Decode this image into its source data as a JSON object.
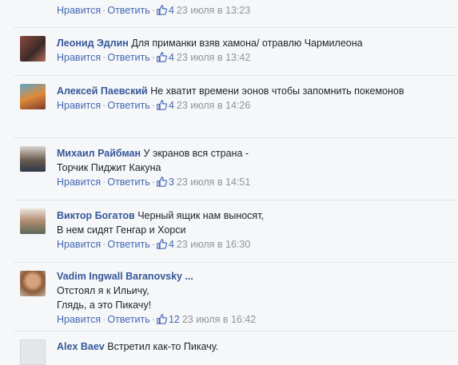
{
  "actions": {
    "like": "Нравится",
    "reply": "Ответить",
    "separator": "·"
  },
  "comments": [
    {
      "author": "",
      "text": "",
      "likes": "4",
      "time": "23 июля в 13:23"
    },
    {
      "author": "Леонид Эдлин",
      "text": "Для приманки взяв хамона/ отравлю Чармилеона",
      "likes": "4",
      "time": "23 июля в 13:42"
    },
    {
      "author": "Алексей Паевский",
      "text": "Не хватит времени эонов чтобы запомнить покемонов",
      "likes": "4",
      "time": "23 июля в 14:26"
    },
    {
      "author": "Михаил Райбман",
      "text": "У экранов вся страна -\nТорчик Пиджит Какуна",
      "likes": "3",
      "time": "23 июля в 14:51"
    },
    {
      "author": "Виктор Богатов",
      "text": "Черный ящик нам выносят,\nВ нем сидят Генгар и Хорси",
      "likes": "4",
      "time": "23 июля в 16:30"
    },
    {
      "author": "Vadim Ingwall Baranovsky ...",
      "text": "Отстоял я к Ильичу,\nГлядь, а это Пикачу!",
      "likes": "12",
      "time": "23 июля в 16:42"
    },
    {
      "author": "Alex Baev",
      "text": "Встретил как-то Пикачу.",
      "likes": "",
      "time": ""
    }
  ],
  "colors": {
    "author": "#365899",
    "link": "#4267b2",
    "meta": "#90949c",
    "text": "#1d2129",
    "background": "#f6f7f9"
  },
  "icons": {
    "like": "thumbs-up-icon"
  }
}
